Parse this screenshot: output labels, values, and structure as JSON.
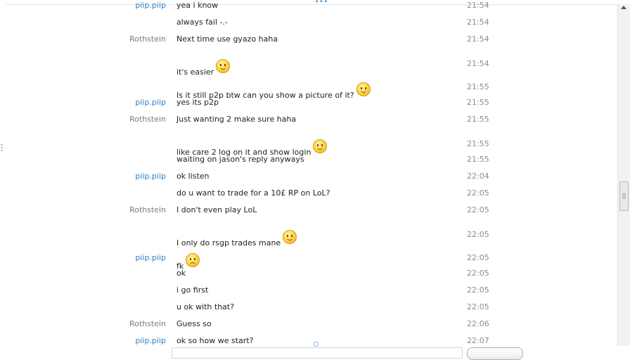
{
  "messages": [
    {
      "sender": "piip.piip",
      "side": "local",
      "text": "yea i know",
      "time": "21:54",
      "emoji": null
    },
    {
      "sender": "",
      "side": "local",
      "text": "always fail -.-",
      "time": "21:54",
      "emoji": null
    },
    {
      "sender": "Rothstein",
      "side": "remote",
      "text": "Next time use gyazo haha",
      "time": "21:54",
      "emoji": null
    },
    {
      "sender": "",
      "side": "remote",
      "text": "it's easier",
      "time": "21:54",
      "emoji": "smile"
    },
    {
      "sender": "",
      "side": "remote",
      "text": "Is it still p2p btw can you show a picture of it?",
      "time": "21:55",
      "emoji": "smile"
    },
    {
      "sender": "piip.piip",
      "side": "local",
      "text": "yes its p2p",
      "time": "21:55",
      "emoji": null
    },
    {
      "sender": "Rothstein",
      "side": "remote",
      "text": "Just wanting 2 make sure haha",
      "time": "21:55",
      "emoji": null
    },
    {
      "sender": "",
      "side": "remote",
      "text": "like care 2 log on it and show login",
      "time": "21:55",
      "emoji": "smile"
    },
    {
      "sender": "",
      "side": "remote",
      "text": "waiting on jason's reply anyways",
      "time": "21:55",
      "emoji": null
    },
    {
      "sender": "piip.piip",
      "side": "local",
      "text": "ok listen",
      "time": "22:04",
      "emoji": null
    },
    {
      "sender": "",
      "side": "local",
      "text": "do u want to trade for a 10£ RP on LoL?",
      "time": "22:05",
      "emoji": null
    },
    {
      "sender": "Rothstein",
      "side": "remote",
      "text": "I don't even play LoL",
      "time": "22:05",
      "emoji": null
    },
    {
      "sender": "",
      "side": "remote",
      "text": "I only do rsgp trades mane",
      "time": "22:05",
      "emoji": "smile"
    },
    {
      "sender": "piip.piip",
      "side": "local",
      "text": "fk",
      "time": "22:05",
      "emoji": "sad"
    },
    {
      "sender": "",
      "side": "local",
      "text": "ok",
      "time": "22:05",
      "emoji": null
    },
    {
      "sender": "",
      "side": "local",
      "text": "i go first",
      "time": "22:05",
      "emoji": null
    },
    {
      "sender": "",
      "side": "local",
      "text": "u ok with that?",
      "time": "22:05",
      "emoji": null
    },
    {
      "sender": "Rothstein",
      "side": "remote",
      "text": "Guess so",
      "time": "22:06",
      "emoji": null
    },
    {
      "sender": "piip.piip",
      "side": "local",
      "text": "ok so how we start?",
      "time": "22:07",
      "emoji": null
    }
  ]
}
